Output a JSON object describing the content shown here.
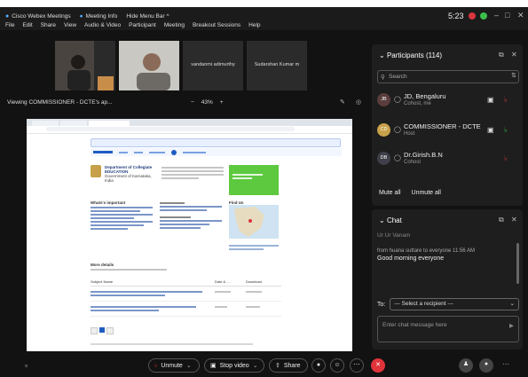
{
  "menubar": {
    "app_title": "Cisco Webex Meetings",
    "meeting_info": "Meeting Info",
    "hide_menu": "Hide Menu Bar ^",
    "menu": [
      "File",
      "Edit",
      "Share",
      "View",
      "Audio & Video",
      "Participant",
      "Meeting",
      "Breakout Sessions",
      "Help"
    ],
    "time": "5:23"
  },
  "thumbnails": [
    {
      "name": ""
    },
    {
      "name": ""
    },
    {
      "name": "vandanmi adimurthy"
    },
    {
      "name": "Sudarshan Kumar m"
    }
  ],
  "viewing": {
    "title": "Viewing COMMISSIONER - DCTE's ap...",
    "zoom_minus": "−",
    "zoom_level": "43%",
    "zoom_plus": "+"
  },
  "shared_page": {
    "org_title_line1": "Department of Collegiate",
    "org_title_line2": "EDUCATION",
    "org_subtitle": "Government of Karnataka, India",
    "sec_notifications": "Whats's important",
    "sec_more": "More details",
    "table_col1": "Subject Name",
    "table_col2": "Date & ...",
    "table_col3": "Download",
    "map_label": "Find Us"
  },
  "participants": {
    "title": "Participants (114)",
    "search_placeholder": "Search",
    "rows": [
      {
        "initials": "JB",
        "name": "JD, Bengaluru",
        "role": "Cohost, me"
      },
      {
        "initials": "CD",
        "name": "COMMISSIONER - DCTE",
        "role": "Host"
      },
      {
        "initials": "DB",
        "name": "Dr.Girish.B.N",
        "role": "Cohost"
      }
    ],
    "mute_all": "Mute all",
    "unmute_all": "Unmute all"
  },
  "chat": {
    "title": "Chat",
    "partial_line": "Ur Ur Vanam",
    "from_line": "from huana suttare to everyone   11:56 AM",
    "message": "Good morning everyone",
    "to_label": "To:",
    "recipient": "--- Select a recipient ---",
    "input_placeholder": "Enter chat message here"
  },
  "controls": {
    "unmute": "Unmute",
    "stop_video": "Stop video",
    "share": "Share"
  },
  "colors": {
    "mic_red": "#d9363e",
    "end_red": "#e0333a",
    "webex_green": "#3bbf4a",
    "shared_blue": "#1f5cc2"
  }
}
